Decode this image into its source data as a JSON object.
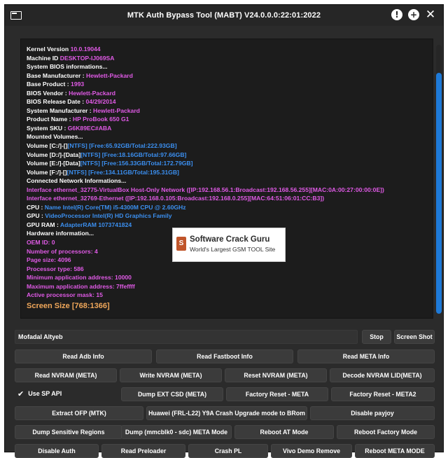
{
  "window": {
    "title": "MTK Auth Bypass Tool (MABT) V24.0.0.0:22:01:2022"
  },
  "titlebar_icons": [
    "app-window-icon",
    "info-icon",
    "add-icon",
    "close-icon"
  ],
  "log": [
    [
      {
        "t": "Kernel Version ",
        "c": "k"
      },
      {
        "t": "10.0.19044",
        "c": "v"
      }
    ],
    [
      {
        "t": "Machine ID ",
        "c": "k"
      },
      {
        "t": "DESKTOP-IJ069SA",
        "c": "v"
      }
    ],
    [
      {
        "t": "System BIOS informations...",
        "c": "k"
      }
    ],
    [
      {
        "t": "Base Manufacturer : ",
        "c": "k"
      },
      {
        "t": "Hewlett-Packard",
        "c": "v"
      }
    ],
    [
      {
        "t": "Base Product : ",
        "c": "k"
      },
      {
        "t": "1993",
        "c": "v"
      }
    ],
    [
      {
        "t": "BIOS Vendor : ",
        "c": "k"
      },
      {
        "t": "Hewlett-Packard",
        "c": "v"
      }
    ],
    [
      {
        "t": "BIOS Release Date : ",
        "c": "k"
      },
      {
        "t": "04/29/2014",
        "c": "v"
      }
    ],
    [
      {
        "t": "System Manufacturer : ",
        "c": "k"
      },
      {
        "t": "Hewlett-Packard",
        "c": "v"
      }
    ],
    [
      {
        "t": "Product Name : ",
        "c": "k"
      },
      {
        "t": "HP ProBook 650 G1",
        "c": "v"
      }
    ],
    [
      {
        "t": "System SKU : ",
        "c": "k"
      },
      {
        "t": "G6K89EC#ABA",
        "c": "v"
      }
    ],
    [
      {
        "t": "Mounted Volumes...",
        "c": "k"
      }
    ],
    [
      {
        "t": "Volume [C:/]-[]",
        "c": "k"
      },
      {
        "t": "[NTFS] [Free:65.92GB/Total:222.93GB]",
        "c": "b"
      }
    ],
    [
      {
        "t": "Volume [D:/]-[Data]",
        "c": "k"
      },
      {
        "t": "[NTFS] [Free:18.16GB/Total:97.66GB]",
        "c": "b"
      }
    ],
    [
      {
        "t": "Volume [E:/]-[Data]",
        "c": "k"
      },
      {
        "t": "[NTFS] [Free:156.33GB/Total:172.79GB]",
        "c": "b"
      }
    ],
    [
      {
        "t": "Volume [F:/]-[]",
        "c": "k"
      },
      {
        "t": "[NTFS] [Free:134.11GB/Total:195.31GB]",
        "c": "b"
      }
    ],
    [
      {
        "t": "Connected Network Informations...",
        "c": "k"
      }
    ],
    [
      {
        "t": "Interface ethernet_32775-VirtualBox Host-Only Network ([IP:192.168.56.1:Broadcast:192.168.56.255][MAC:0A:00:27:00:00:0E])",
        "c": "v"
      }
    ],
    [
      {
        "t": "Interface ethernet_32769-Ethernet ([IP:192.168.0.105:Broadcast:192.168.0.255][MAC:64:51:06:01:CC:B3])",
        "c": "v"
      }
    ],
    [
      {
        "t": "CPU  : ",
        "c": "k"
      },
      {
        "t": "Name Intel(R) Core(TM) i5-4300M CPU @ 2.60GHz",
        "c": "b"
      }
    ],
    [
      {
        "t": "GPU  : ",
        "c": "k"
      },
      {
        "t": "VideoProcessor Intel(R) HD Graphics Family",
        "c": "b"
      }
    ],
    [
      {
        "t": "GPU RAM  : ",
        "c": "k"
      },
      {
        "t": "AdapterRAM 1073741824",
        "c": "b"
      }
    ],
    [
      {
        "t": "Hardware information...",
        "c": "k"
      }
    ],
    [
      {
        "t": "OEM ID: 0",
        "c": "v"
      }
    ],
    [
      {
        "t": "Number of processors: 4",
        "c": "v"
      }
    ],
    [
      {
        "t": "Page size: 4096",
        "c": "v"
      }
    ],
    [
      {
        "t": "Processor type: 586",
        "c": "v"
      }
    ],
    [
      {
        "t": "Minimum application address: 10000",
        "c": "v"
      }
    ],
    [
      {
        "t": "Maximum application address: 7ffeffff",
        "c": "v"
      }
    ],
    [
      {
        "t": "Active processor mask: 15",
        "c": "v"
      }
    ]
  ],
  "screen_size": "Screen Size [768:1366]",
  "watermark": {
    "title": "Software Crack Guru",
    "subtitle": "World's Largest GSM TOOL Site",
    "logo_letter": "S"
  },
  "user_field": {
    "value": "Mofadal Altyeb"
  },
  "stop_button": "Stop",
  "screenshot_button": "Screen Shot",
  "use_sp_api": {
    "label": "Use SP API",
    "checked": true
  },
  "button_rows": [
    [
      "Read Adb Info",
      "Read Fastboot Info",
      "Read META Info"
    ],
    [
      "Read NVRAM (META)",
      "Write NVRAM (META)",
      "Reset NVRAM (META)",
      "Decode NVRAM LID(META)"
    ],
    [
      "Dump  EXT CSD (META)",
      "Factory Reset - META",
      "Factory Reset - META2"
    ],
    [
      "Extract OFP (MTK)",
      "Huawei (FRL-L22) Y9A Crash Upgrade mode to BRom",
      "Disable payjoy"
    ],
    [
      "Dump Sensitive Regions",
      "Dump (mmcblk0 - sdc) META Mode",
      "Reboot  AT Mode",
      "Reboot  Factory Mode"
    ],
    [
      "Disable Auth",
      "Read Preloader",
      "Crash PL",
      "Vivo Demo Remove",
      "Reboot META MODE"
    ]
  ],
  "colors": {
    "window_bg": "#2b2b2b",
    "panel_bg": "#1c1c1c",
    "key_text": "#ffffff",
    "value_text": "#e05ae6",
    "blue_text": "#3b8ff0",
    "accent_scroll": "#1e7ad8",
    "screen_size_text": "#f0a75a"
  }
}
